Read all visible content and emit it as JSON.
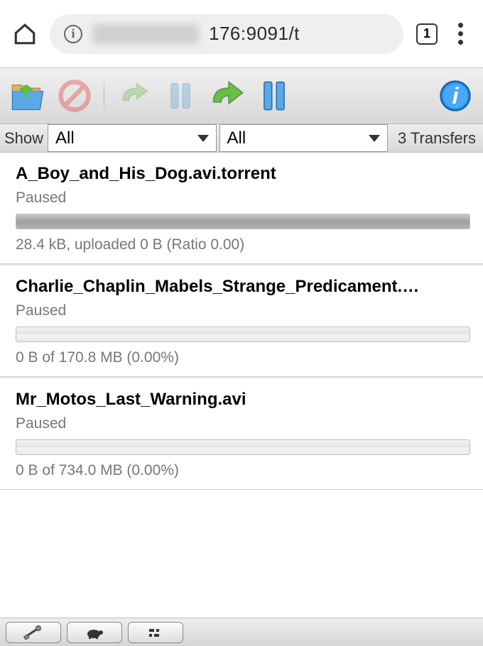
{
  "browser": {
    "url_visible": "176:9091/t",
    "tab_count": "1"
  },
  "filter": {
    "label": "Show",
    "state_select": "All",
    "tracker_select": "All",
    "count_text": "3 Transfers"
  },
  "torrents": [
    {
      "name": "A_Boy_and_His_Dog.avi.torrent",
      "status": "Paused",
      "stats": "28.4 kB, uploaded 0 B (Ratio 0.00)",
      "complete": true
    },
    {
      "name": "Charlie_Chaplin_Mabels_Strange_Predicament.…",
      "status": "Paused",
      "stats": "0 B of 170.8 MB (0.00%)",
      "complete": false
    },
    {
      "name": "Mr_Motos_Last_Warning.avi",
      "status": "Paused",
      "stats": "0 B of 734.0 MB (0.00%)",
      "complete": false
    }
  ]
}
